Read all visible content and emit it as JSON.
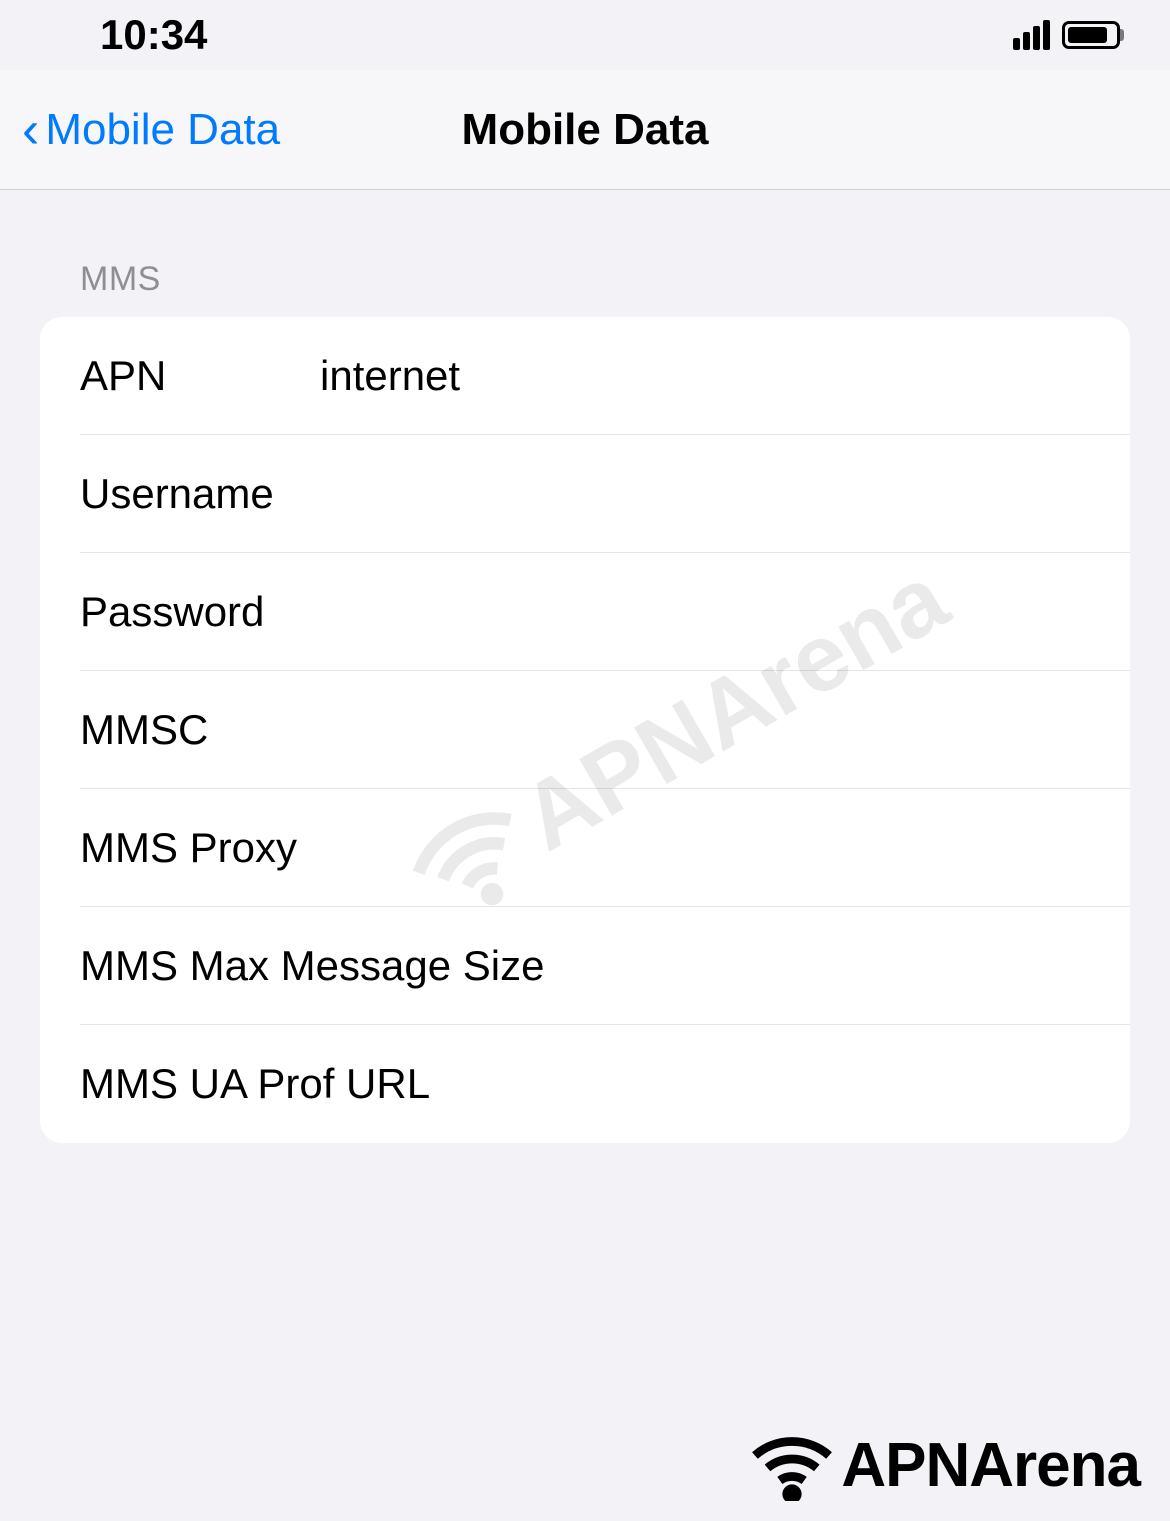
{
  "status_bar": {
    "time": "10:34"
  },
  "nav": {
    "back_label": "Mobile Data",
    "title": "Mobile Data"
  },
  "section": {
    "header": "MMS",
    "rows": [
      {
        "label": "APN",
        "value": "internet"
      },
      {
        "label": "Username",
        "value": ""
      },
      {
        "label": "Password",
        "value": ""
      },
      {
        "label": "MMSC",
        "value": ""
      },
      {
        "label": "MMS Proxy",
        "value": ""
      },
      {
        "label": "MMS Max Message Size",
        "value": ""
      },
      {
        "label": "MMS UA Prof URL",
        "value": ""
      }
    ]
  },
  "watermark": {
    "text": "APNArena"
  },
  "footer": {
    "brand": "APNArena"
  }
}
